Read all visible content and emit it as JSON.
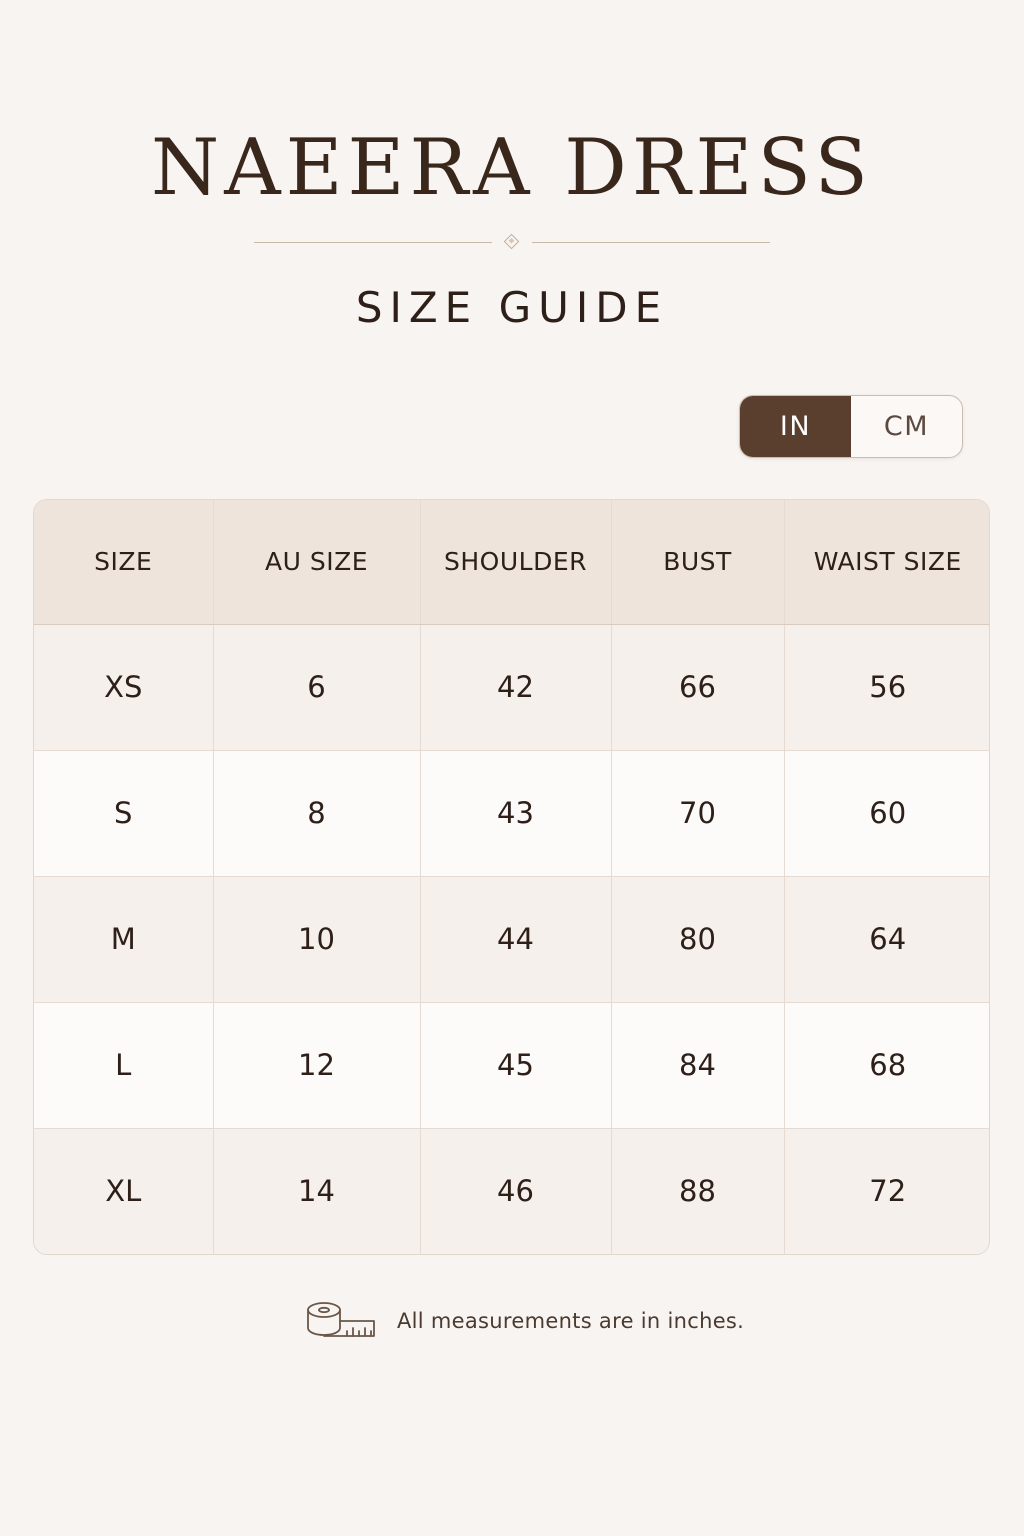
{
  "header": {
    "title": "NAEERA DRESS",
    "subtitle": "SIZE GUIDE"
  },
  "unit_toggle": {
    "options": [
      {
        "label": "IN",
        "selected": true
      },
      {
        "label": "CM",
        "selected": false
      }
    ]
  },
  "size_table": {
    "columns": [
      "SIZE",
      "AU SIZE",
      "SHOULDER",
      "BUST",
      "WAIST SIZE"
    ],
    "rows": [
      [
        "XS",
        "6",
        "42",
        "66",
        "56"
      ],
      [
        "S",
        "8",
        "43",
        "70",
        "60"
      ],
      [
        "M",
        "10",
        "44",
        "80",
        "64"
      ],
      [
        "L",
        "12",
        "45",
        "84",
        "68"
      ],
      [
        "XL",
        "14",
        "46",
        "88",
        "72"
      ]
    ]
  },
  "footer": {
    "icon": "measuring-tape-icon",
    "note": "All measurements are in inches."
  },
  "colors": {
    "background": "#f8f4f1",
    "accent": "#5b3f2e",
    "header_row": "#eee4dc"
  }
}
